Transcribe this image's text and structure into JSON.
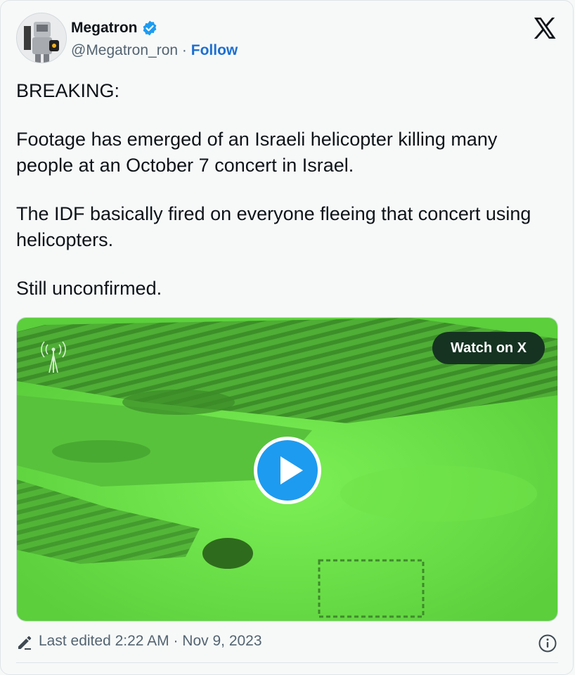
{
  "tweet": {
    "author_name": "Megatron",
    "handle": "@Megatron_ron",
    "separator": " · ",
    "follow_label": "Follow",
    "paragraphs": [
      "BREAKING:",
      "Footage has emerged of an Israeli helicopter killing many people at an October 7 concert in Israel.",
      "The IDF basically fired on everyone fleeing that concert using helicopters.",
      "Still unconfirmed."
    ],
    "media": {
      "watch_label": "Watch on X"
    },
    "edited_text": "Last edited 2:22 AM · Nov 9, 2023"
  },
  "colors": {
    "accent": "#1d9bf0",
    "follow": "#1d6fd1",
    "video_green": "#6be04a",
    "watch_bg": "#163322",
    "play_button": "#1d9bf0"
  },
  "icons": {
    "verified": "verified-badge-icon",
    "brand": "x-logo-icon",
    "play": "play-icon",
    "edit": "pencil-icon",
    "info": "info-icon"
  }
}
